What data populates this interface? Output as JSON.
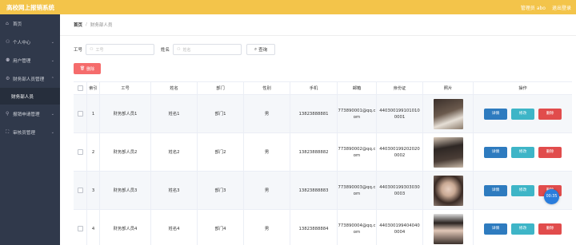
{
  "app": {
    "title": "高校网上报销系统",
    "user_text": "管理员 abo",
    "logout_label": "退出登录"
  },
  "sidebar": {
    "items": [
      {
        "icon": "home-icon",
        "glyph": "⌂",
        "label": "首页"
      },
      {
        "icon": "user-icon",
        "glyph": "⚇",
        "label": "个人中心",
        "arrow": "⌄"
      },
      {
        "icon": "users-icon",
        "glyph": "⚉",
        "label": "用户管理",
        "arrow": "⌄"
      },
      {
        "icon": "gear-icon",
        "glyph": "⚙",
        "label": "财务部人员管理",
        "arrow": "⌃"
      }
    ],
    "sub_item": "财务部人员",
    "items_after": [
      {
        "icon": "pin-icon",
        "glyph": "⚲",
        "label": "报销申请管理",
        "arrow": "⌄"
      },
      {
        "icon": "expand-icon",
        "glyph": "⛶",
        "label": "审核员管理",
        "arrow": "⌄"
      }
    ]
  },
  "breadcrumb": {
    "home": "首页",
    "sep": "/",
    "current": "财务部人员"
  },
  "filters": {
    "gonghao_label": "工号",
    "gonghao_placeholder": "工号",
    "name_label": "姓名",
    "name_placeholder": "姓名",
    "query_label": "查询"
  },
  "delete_label": "删除",
  "table": {
    "headers": [
      "",
      "索引",
      "工号",
      "姓名",
      "部门",
      "性别",
      "手机",
      "邮箱",
      "身份证",
      "照片",
      "操作"
    ],
    "rows": [
      {
        "index": "1",
        "gonghao": "财务部人员1",
        "name": "姓名1",
        "dept": "部门1",
        "gender": "男",
        "phone": "13823888881",
        "email_1": "773890001@qq.c",
        "email_2": "om",
        "idcard_1": "440300199101010",
        "idcard_2": "0001"
      },
      {
        "index": "2",
        "gonghao": "财务部人员2",
        "name": "姓名2",
        "dept": "部门2",
        "gender": "男",
        "phone": "13823888882",
        "email_1": "773890002@qq.c",
        "email_2": "om",
        "idcard_1": "440300199202020",
        "idcard_2": "0002"
      },
      {
        "index": "3",
        "gonghao": "财务部人员3",
        "name": "姓名3",
        "dept": "部门3",
        "gender": "男",
        "phone": "13823888883",
        "email_1": "773890003@qq.c",
        "email_2": "om",
        "idcard_1": "440300199303030",
        "idcard_2": "0003"
      },
      {
        "index": "4",
        "gonghao": "财务部人员4",
        "name": "姓名4",
        "dept": "部门4",
        "gender": "男",
        "phone": "13823888884",
        "email_1": "773890004@qq.c",
        "email_2": "om",
        "idcard_1": "440300199404040",
        "idcard_2": "0004"
      }
    ],
    "op_detail": "详情",
    "op_edit": "修改",
    "op_delete": "删除"
  },
  "timer_text": "00:35",
  "colors": {
    "topbar": "#f3c44a",
    "sidebar": "#30394b",
    "danger": "#f56c6c",
    "primary": "#2e7bbf",
    "info": "#3eb5c7"
  }
}
